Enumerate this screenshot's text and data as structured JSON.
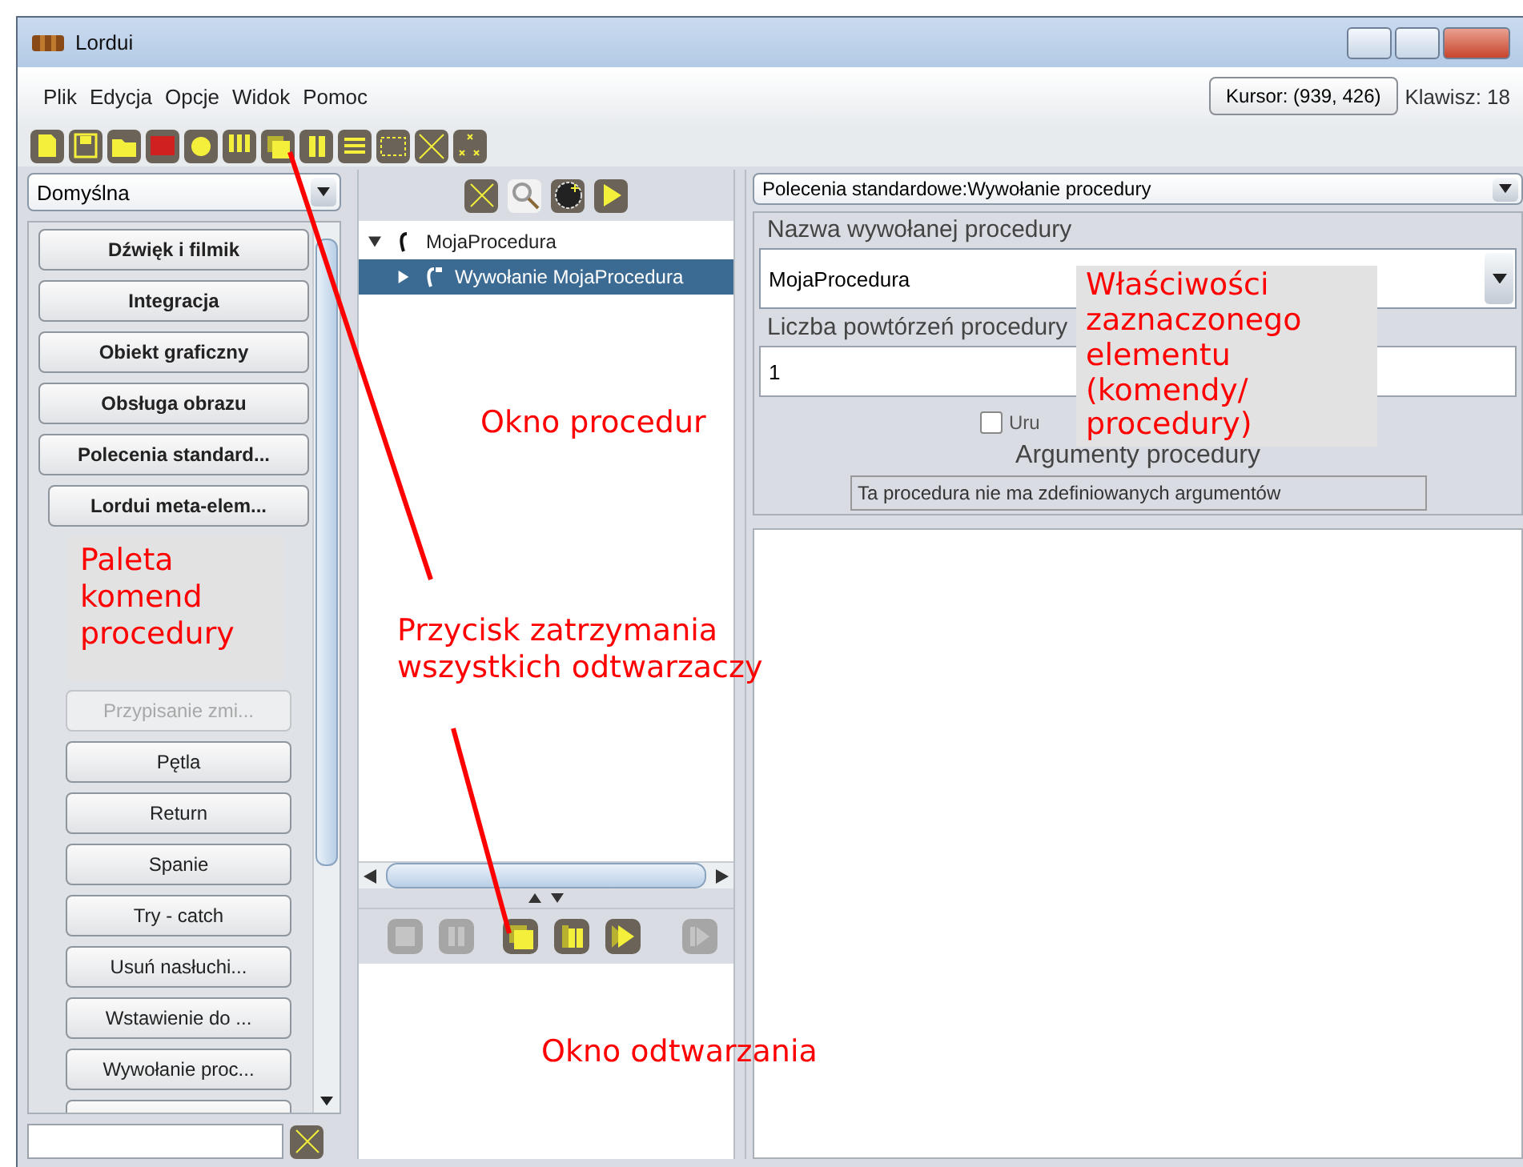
{
  "window": {
    "title": "Lordui"
  },
  "menu": [
    "Plik",
    "Edycja",
    "Opcje",
    "Widok",
    "Pomoc"
  ],
  "cursor_button": "Kursor: (939, 426)",
  "key_label": "Klawisz: 18",
  "palette": {
    "selector": "Domyślna",
    "categories": [
      {
        "label": "Dźwięk i filmik"
      },
      {
        "label": "Integracja"
      },
      {
        "label": "Obiekt graficzny"
      },
      {
        "label": "Obsługa obrazu"
      },
      {
        "label": "Polecenia standard...",
        "children": [
          {
            "kind": "group",
            "label": "Lordui meta-elem...",
            "disabled": false
          },
          {
            "kind": "note",
            "text": "Paleta komend procedury"
          },
          {
            "kind": "command",
            "label": "Przypisanie zmi...",
            "disabled": true
          },
          {
            "kind": "command",
            "label": "Pętla",
            "disabled": false
          },
          {
            "kind": "command",
            "label": "Return",
            "disabled": false
          },
          {
            "kind": "command",
            "label": "Spanie",
            "disabled": false
          },
          {
            "kind": "command",
            "label": "Try - catch",
            "disabled": false
          },
          {
            "kind": "command",
            "label": "Usuń nasłuchi...",
            "disabled": false
          },
          {
            "kind": "command",
            "label": "Wstawienie do ...",
            "disabled": false
          },
          {
            "kind": "command",
            "label": "Wywołanie proc...",
            "disabled": false
          },
          {
            "kind": "command"
          }
        ]
      }
    ]
  },
  "tree": [
    {
      "label": "MojaProcedura",
      "expanded": true,
      "selected": false,
      "children": [
        {
          "label": "Wywołanie MojaProcedura",
          "expanded": false,
          "selected": true
        }
      ]
    }
  ],
  "player_buttons": [
    {
      "kind": "stop",
      "disabled": true
    },
    {
      "kind": "pause",
      "disabled": true
    },
    {
      "kind": "stop-all",
      "disabled": false
    },
    {
      "kind": "pause-all",
      "disabled": false
    },
    {
      "kind": "play-all",
      "disabled": false
    },
    {
      "kind": "step",
      "disabled": true
    }
  ],
  "properties": {
    "selector": "Polecenia standardowe:Wywołanie procedury",
    "name_label": "Nazwa wywołanej procedury",
    "name_value": "MojaProcedura",
    "repeat_label": "Liczba powtórzeń procedury",
    "repeat_value": "1",
    "thread_checkbox": {
      "label": "Uru",
      "checked": false
    },
    "arguments_label": "Argumenty procedury",
    "arguments_note": "Ta procedura nie ma zdefiniowanych argumentów"
  },
  "annotations": [
    {
      "kind": "procedures",
      "text": "Okno procedur"
    },
    {
      "kind": "stop-button",
      "text": "Przycisk zatrzymania wszystkich odtwarzaczy"
    },
    {
      "kind": "player",
      "text": "Okno odtwarzania"
    },
    {
      "kind": "properties",
      "text": "Właściwości zaznaczonego elementu (komendy/ procedury)"
    }
  ]
}
